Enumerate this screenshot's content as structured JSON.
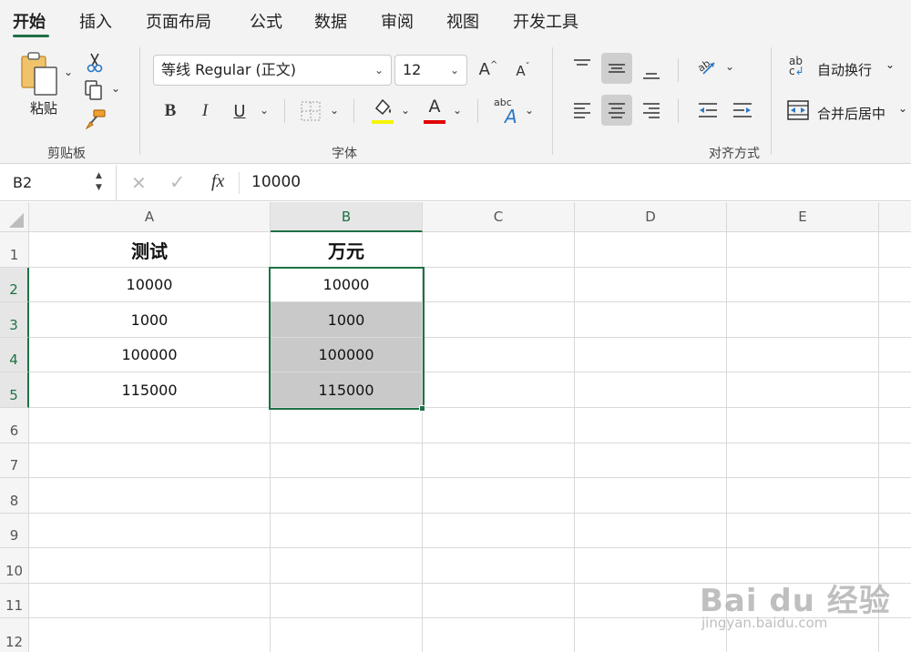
{
  "menu": {
    "tabs": [
      "开始",
      "插入",
      "页面布局",
      "公式",
      "数据",
      "审阅",
      "视图",
      "开发工具"
    ],
    "active_tab": "开始"
  },
  "ribbon": {
    "clipboard": {
      "paste_label": "粘贴",
      "group_label": "剪贴板"
    },
    "font": {
      "font_name": "等线 Regular (正文)",
      "font_size": "12",
      "grow_glyph": "A",
      "shrink_glyph": "A",
      "bold_glyph": "B",
      "italic_glyph": "I",
      "underline_glyph": "U",
      "font_color_glyph": "A",
      "abc_glyph": "abc",
      "highlight_color": "#f5f500",
      "font_color": "#e00000",
      "group_label": "字体"
    },
    "alignment": {
      "wrap_label": "自动换行",
      "merge_label": "合并后居中",
      "wrap_glyph": "ab",
      "group_label": "对齐方式"
    }
  },
  "formula_bar": {
    "name_box": "B2",
    "fx_glyph": "fx",
    "value": "10000"
  },
  "sheet": {
    "columns": [
      "A",
      "B",
      "C",
      "D",
      "E"
    ],
    "selected_column": "B",
    "rows": [
      "1",
      "2",
      "3",
      "4",
      "5",
      "6",
      "7",
      "8",
      "9",
      "10",
      "11",
      "12"
    ],
    "selected_rows": [
      "2",
      "3",
      "4",
      "5"
    ],
    "cells": {
      "A1": "测试",
      "B1": "万元",
      "A2": "10000",
      "B2": "10000",
      "A3": "1000",
      "B3": "1000",
      "A4": "100000",
      "B4": "100000",
      "A5": "115000",
      "B5": "115000"
    },
    "accent_color": "#1e7145",
    "shade_color": "#c9c9c9"
  },
  "watermark": {
    "brand": "Bai du 经验",
    "url": "jingyan.baidu.com"
  }
}
